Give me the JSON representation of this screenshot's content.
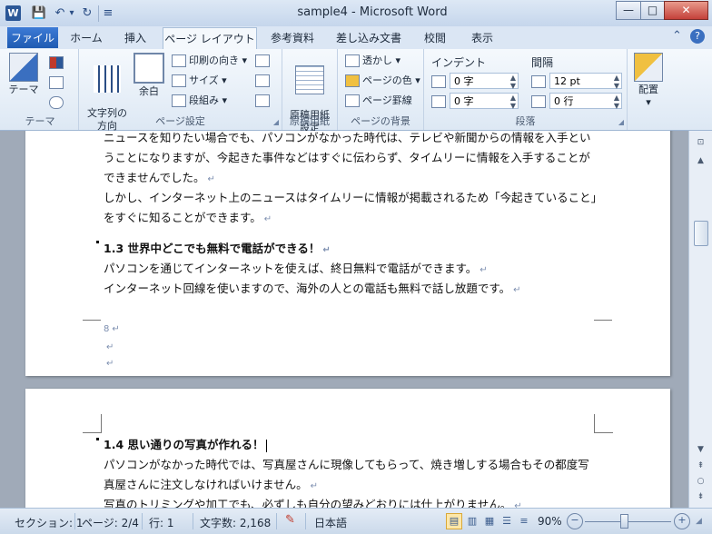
{
  "window": {
    "title": "sample4 - Microsoft Word",
    "app_icon_letter": "W",
    "buttons": {
      "minimize": "—",
      "maximize": "□",
      "close": "✕"
    }
  },
  "qat": {
    "save_icon": "💾",
    "undo_icon": "↶",
    "undo_dropdown": "▾",
    "redo_icon": "↻",
    "customize_icon": "≡"
  },
  "tabs": [
    {
      "label": "ファイル"
    },
    {
      "label": "ホーム"
    },
    {
      "label": "挿入"
    },
    {
      "label": "ページ レイアウト"
    },
    {
      "label": "参考資料"
    },
    {
      "label": "差し込み文書"
    },
    {
      "label": "校閲"
    },
    {
      "label": "表示"
    }
  ],
  "tab_controls": {
    "collapse_icon": "⌃",
    "help_icon": "?"
  },
  "ribbon": {
    "theme": {
      "label": "テーマ",
      "big_button": "テーマ",
      "group_label": "テーマ"
    },
    "page_setup": {
      "text_direction": "文字列の\n方向",
      "margins": "余白",
      "orientation": "印刷の向き",
      "size": "サイズ",
      "columns": "段組み",
      "group_label": "ページ設定"
    },
    "genkou": {
      "button": "原稿用紙\n設定",
      "group_label": "原稿用紙"
    },
    "background": {
      "watermark": "透かし",
      "page_color": "ページの色",
      "page_borders": "ページ罫線",
      "group_label": "ページの背景"
    },
    "paragraph": {
      "indent_title": "インデント",
      "spacing_title": "間隔",
      "indent_left": "0 字",
      "indent_right": "0 字",
      "spacing_before": "12 pt",
      "spacing_after": "0 行",
      "group_label": "段落"
    },
    "arrange": {
      "button": "配置"
    }
  },
  "document": {
    "page1_lines": [
      "ニュースを知りたい場合でも、パソコンがなかった時代は、テレビや新聞からの情報を入手とい",
      "うことになりますが、今起きた事件などはすぐに伝わらず、タイムリーに情報を入手することが",
      "できませんでした。",
      "しかし、インターネット上のニュースはタイムリーに情報が掲載されるため「今起きていること」",
      "をすぐに知ることができます。"
    ],
    "heading_1_3": "1.3 世界中どこでも無料で電話ができる！",
    "body_1_3": [
      "パソコンを通じてインターネットを使えば、終日無料で電話ができます。",
      "インターネット回線を使いますので、海外の人との電話も無料で話し放題です。"
    ],
    "heading_1_4": "1.4 思い通りの写真が作れる！",
    "body_1_4": [
      "パソコンがなかった時代では、写真屋さんに現像してもらって、焼き増しする場合もその都度写",
      "真屋さんに注文しなければいけません。",
      "写真のトリミングや加工でも、必ずしも自分の望みどおりには仕上がりません。"
    ],
    "para_mark": "↵",
    "footnote_marker": "8"
  },
  "statusbar": {
    "section": "セクション: 1",
    "page": "ページ: 2/4",
    "line": "行: 1",
    "word_count": "文字数: 2,168",
    "language": "日本語",
    "zoom": "90%",
    "zoom_fraction": 0.45
  }
}
